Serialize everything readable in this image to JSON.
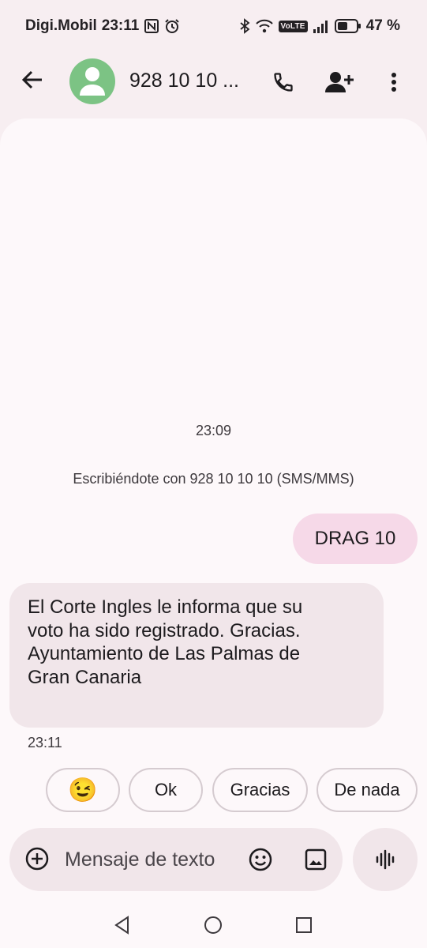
{
  "status_bar": {
    "carrier": "Digi.Mobil",
    "time": "23:11",
    "battery": "47 %",
    "volte_label": "VoLTE",
    "icons": [
      "nfc-icon",
      "alarm-icon",
      "bluetooth-icon",
      "wifi-icon",
      "volte-icon",
      "signal-icon",
      "battery-icon"
    ]
  },
  "header": {
    "contact_name": "928 10 10 ...",
    "icons": [
      "back-arrow-icon",
      "person-avatar-icon",
      "phone-icon",
      "add-person-icon",
      "more-vert-icon"
    ],
    "avatar_color": "#7cc384"
  },
  "conversation": {
    "timestamp": "23:09",
    "info": "Escribiéndote con 928 10 10 10 (SMS/MMS)",
    "messages": [
      {
        "direction": "outgoing",
        "text": "DRAG 10"
      },
      {
        "direction": "incoming",
        "lines": [
          "El Corte Ingles le informa que su",
          "voto ha sido registrado. Gracias.",
          "Ayuntamiento de Las Palmas de",
          "Gran Canaria"
        ],
        "time": "23:11"
      }
    ]
  },
  "smart_replies": {
    "emoji": "😉",
    "items": [
      "Ok",
      "Gracias",
      "De nada"
    ]
  },
  "compose": {
    "placeholder": "Mensaje de texto",
    "icons": [
      "add-circle-icon",
      "emoji-icon",
      "gallery-icon",
      "voice-waveform-icon"
    ]
  },
  "nav_bar": {
    "icons": [
      "nav-back-icon",
      "nav-home-icon",
      "nav-recents-icon"
    ]
  },
  "colors": {
    "background": "#f7eef1",
    "conversation_bg": "#fdf8fa",
    "outgoing_bubble": "#f6d9e8",
    "incoming_bubble": "#f1e6ea"
  }
}
